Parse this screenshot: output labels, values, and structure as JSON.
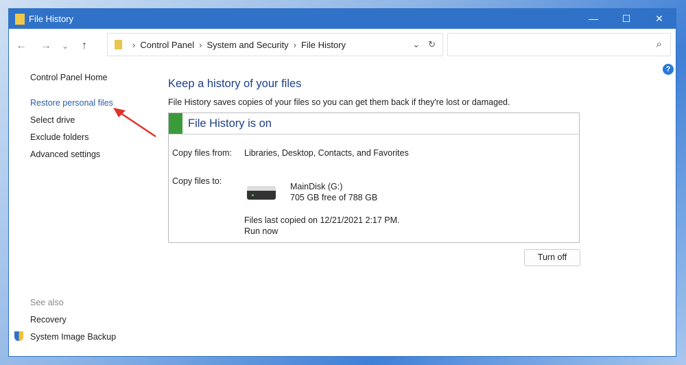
{
  "window": {
    "title": "File History",
    "minimize": "—",
    "maximize": "☐",
    "close": "✕"
  },
  "nav": {
    "back": "←",
    "forward": "→",
    "recent": "⌄",
    "up": "↑",
    "refresh": "↻",
    "dropdown": "⌄",
    "search_icon": "⌕"
  },
  "breadcrumb": [
    "Control Panel",
    "System and Security",
    "File History"
  ],
  "sidebar": {
    "items": [
      "Control Panel Home",
      "Restore personal files",
      "Select drive",
      "Exclude folders",
      "Advanced settings"
    ],
    "see_also": "See also",
    "also_items": [
      "Recovery",
      "System Image Backup"
    ]
  },
  "main": {
    "title": "Keep a history of your files",
    "description": "File History saves copies of your files so you can get them back if they're lost or damaged.",
    "status": "File History is on",
    "copy_from_label": "Copy files from:",
    "copy_from_value": "Libraries, Desktop, Contacts, and Favorites",
    "copy_to_label": "Copy files to:",
    "drive_name": "MainDisk (G:)",
    "drive_space": "705 GB free of 788 GB",
    "last_copied": "Files last copied on 12/21/2021 2:17 PM.",
    "run_now": "Run now",
    "turn_off": "Turn off",
    "help": "?"
  },
  "colors": {
    "accent": "#3172c9",
    "status_green": "#3b9a3a",
    "annotation_arrow": "#e0322a"
  }
}
